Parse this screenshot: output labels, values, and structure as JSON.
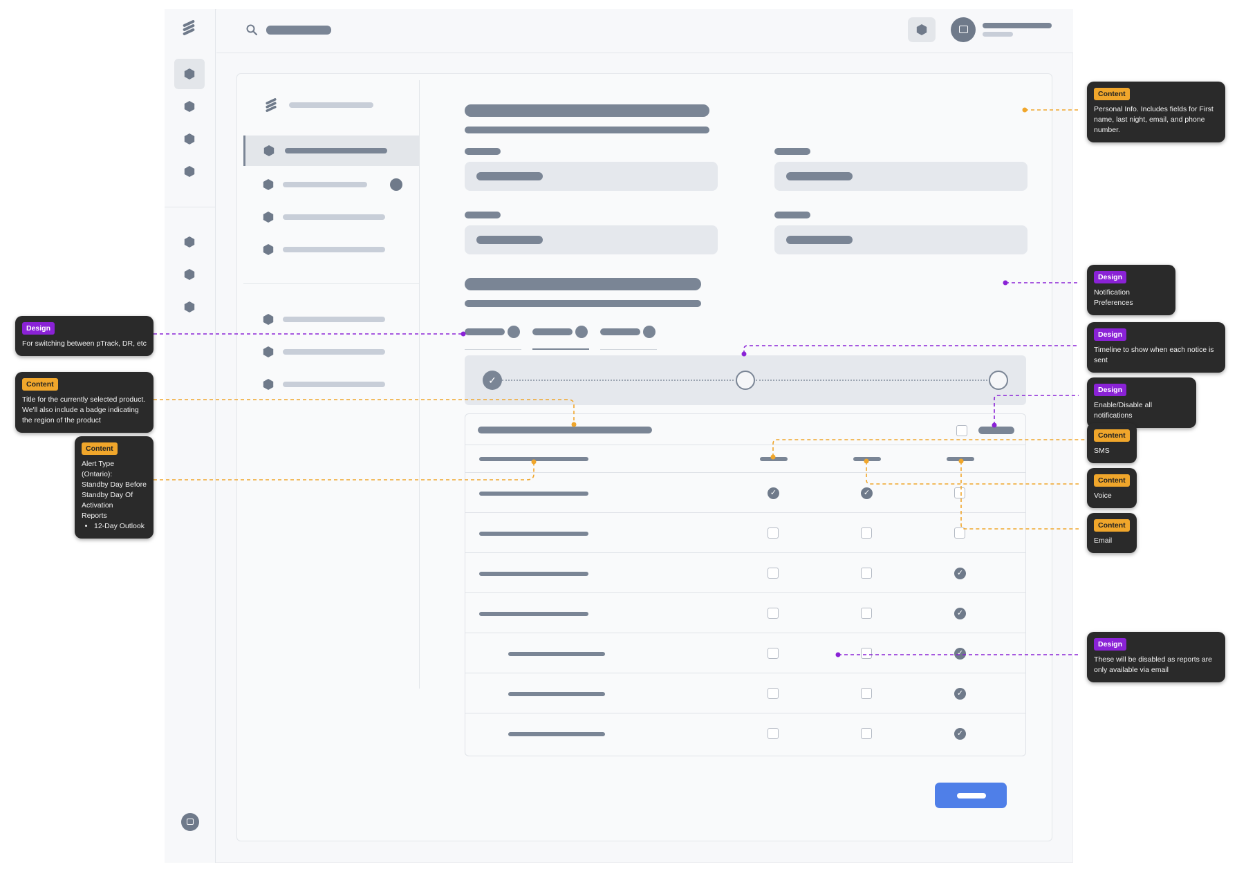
{
  "notes": {
    "personal_info": {
      "tag": "Content",
      "text": "Personal Info. Includes fields for First name, last night, email, and phone number."
    },
    "notification_prefs": {
      "tag": "Design",
      "text": "Notification Preferences"
    },
    "timeline": {
      "tag": "Design",
      "text": "Timeline to show when each notice is sent"
    },
    "enable_disable": {
      "tag": "Design",
      "text": "Enable/Disable all notifications"
    },
    "sms": {
      "tag": "Content",
      "text": "SMS"
    },
    "voice": {
      "tag": "Content",
      "text": "Voice"
    },
    "email": {
      "tag": "Content",
      "text": "Email"
    },
    "reports_disabled": {
      "tag": "Design",
      "text": "These will be disabled as reports are only available via email"
    },
    "product_switch": {
      "tag": "Design",
      "text": "For switching between pTrack, DR, etc"
    },
    "product_title": {
      "tag": "Content",
      "text": "Title for the currently selected product. We'll also include a badge indicating the region of the product"
    },
    "alert_type": {
      "tag": "Content",
      "lines": [
        "Alert Type (Ontario):",
        "Standby Day Before",
        "Standby Day Of",
        "Activation",
        "Reports"
      ],
      "bullet": "12-Day Outlook"
    }
  },
  "table": {
    "rows": [
      {
        "sms": true,
        "voice": true,
        "email": false
      },
      {
        "sms": false,
        "voice": false,
        "email": false
      },
      {
        "sms": false,
        "voice": false,
        "email": true
      },
      {
        "sms": false,
        "voice": false,
        "email": true
      },
      {
        "sms": false,
        "voice": false,
        "email": true
      },
      {
        "sms": false,
        "voice": false,
        "email": true
      },
      {
        "sms": false,
        "voice": false,
        "email": true
      }
    ]
  },
  "timeline": {
    "steps": [
      "done",
      "open",
      "open"
    ]
  },
  "colors": {
    "design": "#8a22d6",
    "content": "#f0a62b",
    "primary_button": "#4f7fe8",
    "wire_dark": "#7a8595"
  }
}
